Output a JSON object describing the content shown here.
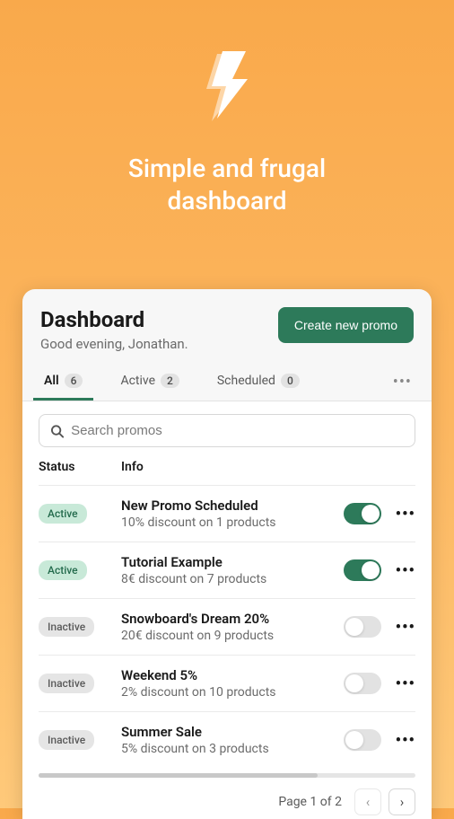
{
  "hero": {
    "title_line1": "Simple and frugal",
    "title_line2": "dashboard"
  },
  "header": {
    "title": "Dashboard",
    "greeting": "Good evening, Jonathan.",
    "create_button": "Create new promo"
  },
  "tabs": [
    {
      "label": "All",
      "count": "6",
      "active": true
    },
    {
      "label": "Active",
      "count": "2",
      "active": false
    },
    {
      "label": "Scheduled",
      "count": "0",
      "active": false
    }
  ],
  "search": {
    "placeholder": "Search promos"
  },
  "table": {
    "head_status": "Status",
    "head_info": "Info"
  },
  "rows": [
    {
      "status": "Active",
      "status_kind": "active",
      "title": "New Promo Scheduled",
      "sub": "10% discount on 1 products",
      "on": true
    },
    {
      "status": "Active",
      "status_kind": "active",
      "title": "Tutorial Example",
      "sub": "8€ discount on 7 products",
      "on": true
    },
    {
      "status": "Inactive",
      "status_kind": "inactive",
      "title": "Snowboard's Dream 20%",
      "sub": "20€ discount on 9 products",
      "on": false
    },
    {
      "status": "Inactive",
      "status_kind": "inactive",
      "title": "Weekend 5%",
      "sub": "2% discount on 10 products",
      "on": false
    },
    {
      "status": "Inactive",
      "status_kind": "inactive",
      "title": "Summer Sale",
      "sub": "5% discount on 3 products",
      "on": false
    }
  ],
  "pager": {
    "text": "Page 1 of 2",
    "prev": "‹",
    "next": "›"
  }
}
